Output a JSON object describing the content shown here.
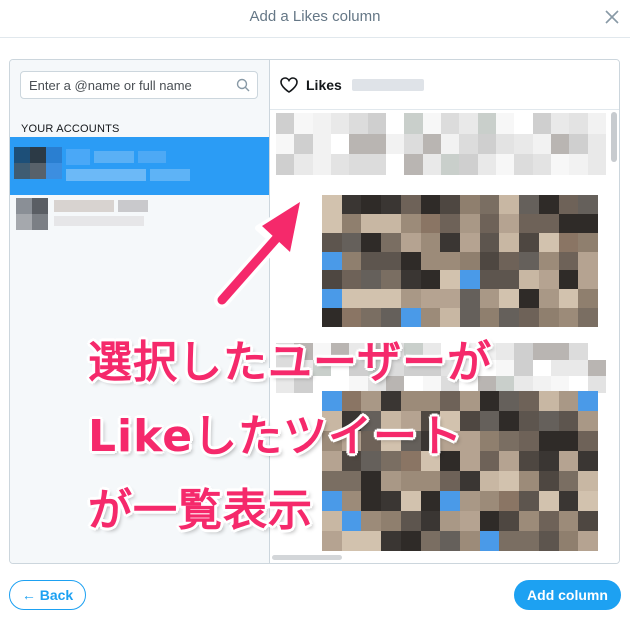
{
  "modal": {
    "title": "Add a Likes column",
    "close_icon": "close-icon"
  },
  "accounts_panel": {
    "search_placeholder": "Enter a @name or full name",
    "search_value": "",
    "section_label": "YOUR ACCOUNTS"
  },
  "column_preview": {
    "title": "Likes",
    "icon": "heart-icon"
  },
  "annotation": {
    "lines": [
      "選択したユーザーが",
      "Likeしたツイート",
      "が一覧表示"
    ],
    "color": "#f5296b"
  },
  "footer": {
    "back_label": "← Back",
    "add_label": "Add column"
  },
  "colors": {
    "accent": "#1da1f2",
    "selected_row": "#2b9cf5"
  }
}
